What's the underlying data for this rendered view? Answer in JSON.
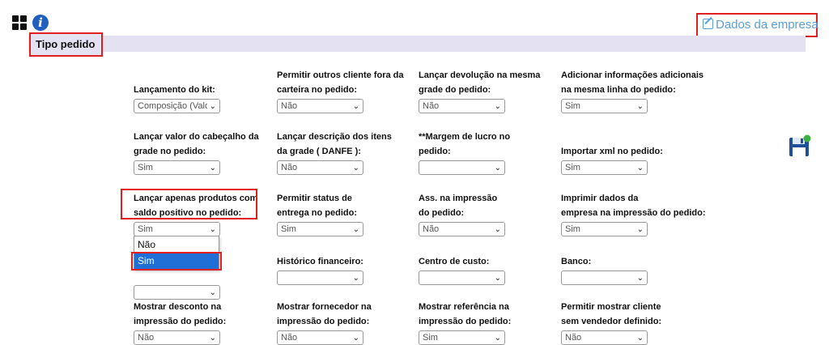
{
  "header": {
    "company_link": "Dados da empresa"
  },
  "section": {
    "title": "Tipo pedido"
  },
  "fields": {
    "lancamento_kit": {
      "label": "Lançamento do kit:",
      "value": "Composição (Valor)"
    },
    "outros_cliente": {
      "label1": "Permitir outros cliente fora da",
      "label2": "carteira no pedido:",
      "value": "Não"
    },
    "devolucao": {
      "label1": "Lançar devolução na mesma",
      "label2": "grade do pedido:",
      "value": "Não"
    },
    "info_adicionais": {
      "label1": "Adicionar informações adicionais",
      "label2": "na mesma linha do pedido:",
      "value": "Sim"
    },
    "valor_cabecalho": {
      "label1": "Lançar valor do cabeçalho da",
      "label2": "grade no pedido:",
      "value": "Sim"
    },
    "descricao_itens": {
      "label1": "Lançar descrição dos itens",
      "label2": "da grade ( DANFE ):",
      "value": "Não"
    },
    "margem_lucro": {
      "label1": "**Margem de lucro no",
      "label2": "pedido:",
      "value": ""
    },
    "importar_xml": {
      "label": "Importar xml no pedido:",
      "value": "Sim"
    },
    "saldo_positivo": {
      "label1": "Lançar apenas produtos com",
      "label2": "saldo positivo no pedido:",
      "value": "Sim"
    },
    "status_entrega": {
      "label1": "Permitir status de",
      "label2": "entrega no pedido:",
      "value": "Sim"
    },
    "ass_impressao": {
      "label1": "Ass. na impressão",
      "label2": "do pedido:",
      "value": "Não"
    },
    "dados_empresa": {
      "label1": "Imprimir dados da",
      "label2": "empresa na impressão do pedido:",
      "value": "Sim"
    },
    "historico": {
      "label": "Histórico financeiro:",
      "value": ""
    },
    "centro_custo": {
      "label": "Centro de custo:",
      "value": ""
    },
    "banco": {
      "label": "Banco:",
      "value": ""
    },
    "mostrar_desconto": {
      "label1": "Mostrar desconto na",
      "label2": "impressão do pedido:",
      "value": "Não"
    },
    "mostrar_fornecedor": {
      "label1": "Mostrar fornecedor na",
      "label2": "impressão do pedido:",
      "value": "Não"
    },
    "mostrar_referencia": {
      "label1": "Mostrar referência na",
      "label2": "impressão do pedido:",
      "value": "Sim"
    },
    "cliente_sem_vendedor": {
      "label1": "Permitir mostrar cliente",
      "label2": "sem vendedor definido:",
      "value": "Não"
    }
  },
  "dropdown": {
    "options": [
      "Não",
      "Sim"
    ],
    "selected_index": 1
  },
  "icons": {
    "apps": "grid-icon",
    "info": "info-icon",
    "edit": "edit-icon",
    "save": "save-icon"
  },
  "colors": {
    "highlight": "#e02020",
    "link": "#5aa0d8",
    "section_bg": "#e4e1f2",
    "selected_option": "#1f6fd6"
  }
}
